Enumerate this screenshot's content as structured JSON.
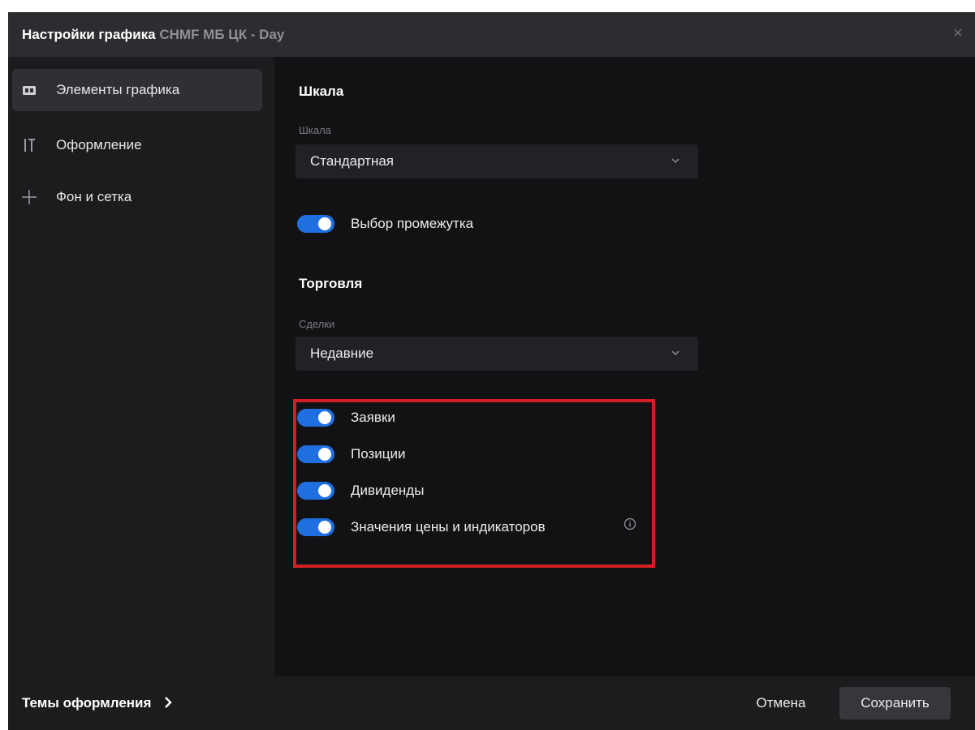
{
  "dialog": {
    "title": "Настройки графика",
    "symbol": "CHMF МБ ЦК - Day",
    "close_glyph": "×"
  },
  "sidebar": {
    "items": [
      {
        "label": "Элементы графика",
        "icon": "chart-elements-icon",
        "active": true
      },
      {
        "label": "Оформление",
        "icon": "appearance-icon",
        "active": false
      },
      {
        "label": "Фон и сетка",
        "icon": "grid-icon",
        "active": false
      }
    ]
  },
  "content": {
    "scale_section": {
      "title": "Шкала",
      "field_label": "Шкала",
      "select_value": "Стандартная",
      "range_toggle": {
        "label": "Выбор промежутка",
        "on": true
      }
    },
    "trading_section": {
      "title": "Торговля",
      "field_label": "Сделки",
      "select_value": "Недавние",
      "toggles": [
        {
          "label": "Заявки",
          "on": true
        },
        {
          "label": "Позиции",
          "on": true
        },
        {
          "label": "Дивиденды",
          "on": true
        },
        {
          "label": "Значения цены и индикаторов",
          "on": true,
          "info_icon": "info-icon"
        }
      ]
    }
  },
  "footer": {
    "themes_label": "Темы оформления",
    "cancel_label": "Отмена",
    "save_label": "Сохранить"
  },
  "colors": {
    "toggle_on": "#1f6fe0",
    "highlight": "#d21f25",
    "title_symbol": "#8f9096"
  }
}
